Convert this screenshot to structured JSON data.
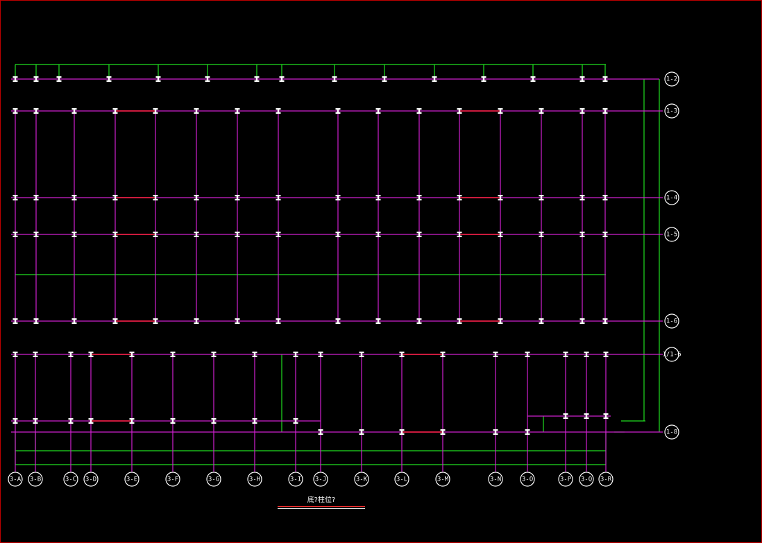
{
  "drawing": {
    "caption": "底?柱位?",
    "colors": {
      "background": "#000000",
      "frame": "#c00000",
      "beam": "#d020d0",
      "aux": "#20e020",
      "column": "#ffffff",
      "highlight": "#ff2040",
      "bubble": "#ffffff"
    }
  },
  "axes": {
    "horizontal": [
      "1-2",
      "1-3",
      "1-4",
      "1-5",
      "1-6",
      "1/1-6",
      "1-8"
    ],
    "vertical": [
      "3-A",
      "3-B",
      "3-C",
      "3-D",
      "3-E",
      "3-F",
      "3-G",
      "3-H",
      "3-I",
      "3-J",
      "3-K",
      "3-L",
      "3-M",
      "3-N",
      "3-O",
      "3-P",
      "3-Q",
      "3-R"
    ]
  }
}
